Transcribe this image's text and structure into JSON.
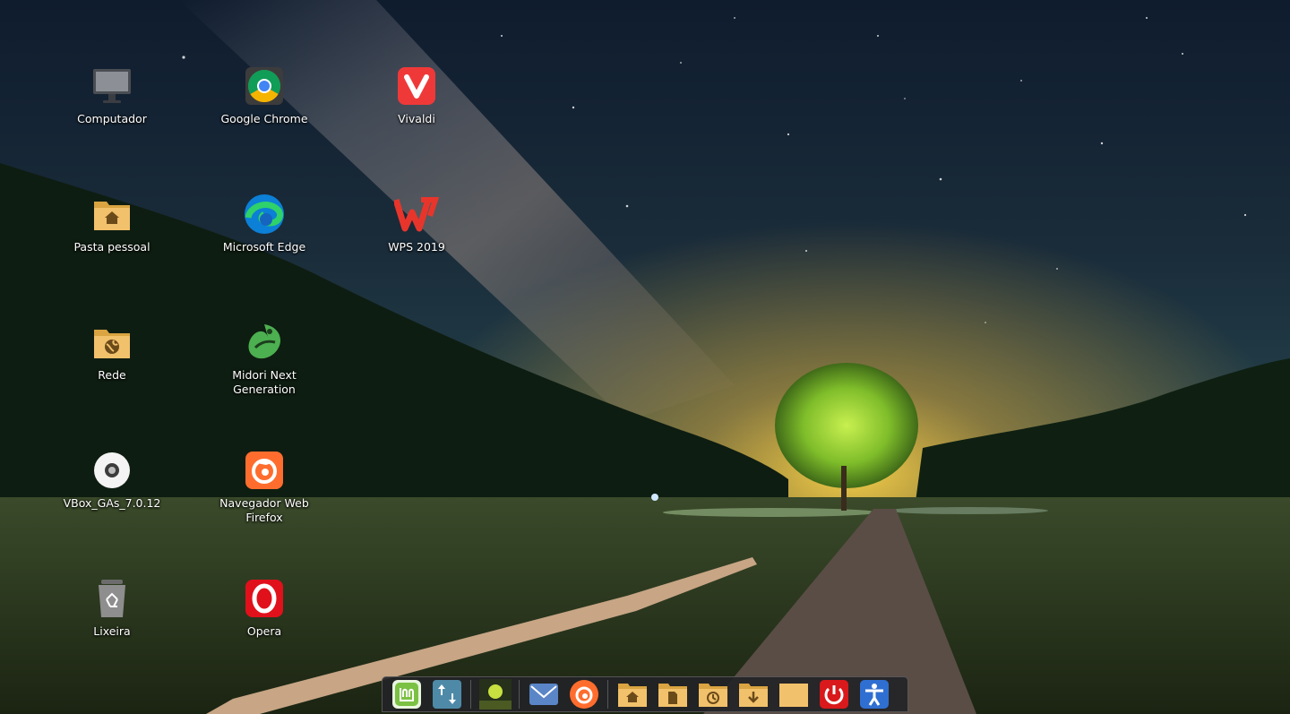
{
  "desktop": {
    "icons": [
      {
        "id": "computer",
        "label": "Computador",
        "icon": "computer-monitor-icon"
      },
      {
        "id": "chrome",
        "label": "Google Chrome",
        "icon": "chrome-icon"
      },
      {
        "id": "vivaldi",
        "label": "Vivaldi",
        "icon": "vivaldi-icon"
      },
      {
        "id": "home",
        "label": "Pasta pessoal",
        "icon": "home-folder-icon"
      },
      {
        "id": "edge",
        "label": "Microsoft Edge",
        "icon": "edge-icon"
      },
      {
        "id": "wps",
        "label": "WPS 2019",
        "icon": "wps-icon"
      },
      {
        "id": "network",
        "label": "Rede",
        "icon": "network-folder-icon"
      },
      {
        "id": "midori",
        "label": "Midori Next Generation",
        "icon": "midori-icon"
      },
      {
        "id": "vbox",
        "label": "VBox_GAs_7.0.12",
        "icon": "disc-icon"
      },
      {
        "id": "firefox",
        "label": "Navegador Web Firefox",
        "icon": "firefox-icon"
      },
      {
        "id": "trash",
        "label": "Lixeira",
        "icon": "trash-icon"
      },
      {
        "id": "opera",
        "label": "Opera",
        "icon": "opera-icon"
      }
    ]
  },
  "dock": {
    "items": [
      "mint-menu-icon",
      "update-manager-icon",
      "wallpaper-thumbnail-icon",
      "mail-icon",
      "firefox-icon",
      "home-folder-icon",
      "documents-folder-icon",
      "recent-folder-icon",
      "downloads-folder-icon",
      "generic-folder-icon",
      "power-icon",
      "accessibility-icon"
    ]
  },
  "colors": {
    "sky_top": "#122033",
    "sky_mid": "#1d3a42",
    "horizon_glow": "#e8b23a",
    "hills": "#0f1f12",
    "field": "#2c3a1e",
    "tree": "#8fd12c",
    "path": "#5e5048",
    "folder": "#f2c16b",
    "power_red": "#d9191c",
    "accessibility_blue": "#2f6fd1"
  }
}
